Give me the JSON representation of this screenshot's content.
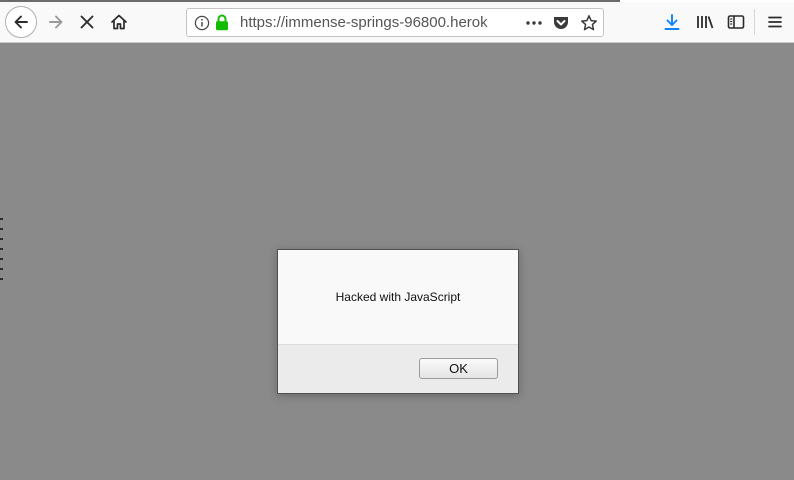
{
  "browser": {
    "url_scheme": "https://",
    "url_host": "immense-springs-96800.herok",
    "icons": {
      "back": "back-arrow-icon",
      "forward": "forward-arrow-icon",
      "stop": "stop-icon",
      "home": "home-icon",
      "info": "info-icon",
      "lock": "lock-icon",
      "more": "more-actions-icon",
      "pocket": "pocket-icon",
      "bookmark": "bookmark-star-icon",
      "downloads": "download-icon",
      "library": "library-icon",
      "sidebar": "sidebar-icon",
      "menu": "hamburger-menu-icon"
    },
    "colors": {
      "lock": "#12bc00",
      "downloads": "#0a84ff",
      "page_overlay": "#8a8a8a"
    }
  },
  "dialog": {
    "message": "Hacked with JavaScript",
    "ok_label": "OK"
  }
}
